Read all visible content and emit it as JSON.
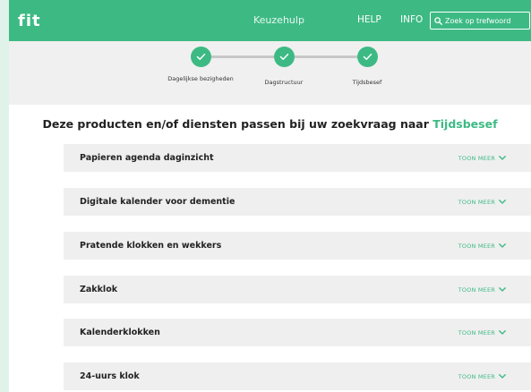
{
  "header": {
    "logo": "fit",
    "title": "Keuzehulp",
    "nav": {
      "help": "HELP",
      "info": "INFO"
    },
    "search_placeholder": "Zoek op trefwoord"
  },
  "stepper": {
    "steps": [
      {
        "label": "Dagelijkse bezigheden",
        "done": true
      },
      {
        "label": "Dagstructuur",
        "done": true
      },
      {
        "label": "Tijdsbesef",
        "done": true
      }
    ]
  },
  "heading": {
    "prefix": "Deze producten en/of diensten passen bij uw zoekvraag naar",
    "highlight": "Tijdsbesef"
  },
  "results": [
    {
      "title": "Papieren agenda daginzicht",
      "toggle": "TOON MEER"
    },
    {
      "title": "Digitale kalender voor dementie",
      "toggle": "TOON MEER"
    },
    {
      "title": "Pratende klokken en wekkers",
      "toggle": "TOON MEER"
    },
    {
      "title": "Zakklok",
      "toggle": "TOON MEER"
    },
    {
      "title": "Kalenderklokken",
      "toggle": "TOON MEER"
    },
    {
      "title": "24-uurs klok",
      "toggle": "TOON MEER"
    }
  ],
  "colors": {
    "brand": "#3dba84",
    "page_background": "#dff3ea",
    "row_background": "#efefef"
  }
}
